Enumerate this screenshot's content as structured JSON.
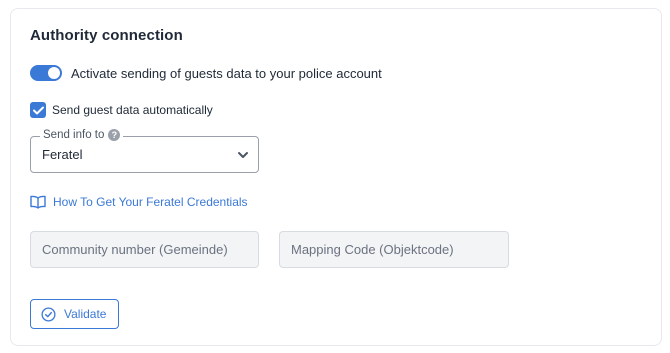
{
  "section": {
    "title": "Authority connection"
  },
  "toggle": {
    "label": "Activate sending of guests data to your police account",
    "on": true
  },
  "auto_send": {
    "label": "Send guest data automatically",
    "checked": true
  },
  "send_info": {
    "legend": "Send info to",
    "help_icon": "question-circle-icon",
    "selected": "Feratel",
    "chevron_icon": "chevron-down-icon"
  },
  "guide": {
    "icon": "book-open-icon",
    "link_text": "How To Get Your Feratel Credentials"
  },
  "fields": {
    "community_placeholder": "Community number (Gemeinde)",
    "mapping_placeholder": "Mapping Code (Objektcode)"
  },
  "validate": {
    "icon": "check-circle-icon",
    "label": "Validate"
  },
  "colors": {
    "accent": "#3b79d6",
    "text": "#1f2937",
    "input_bg": "#f3f4f6",
    "border": "#e7e9ee"
  }
}
